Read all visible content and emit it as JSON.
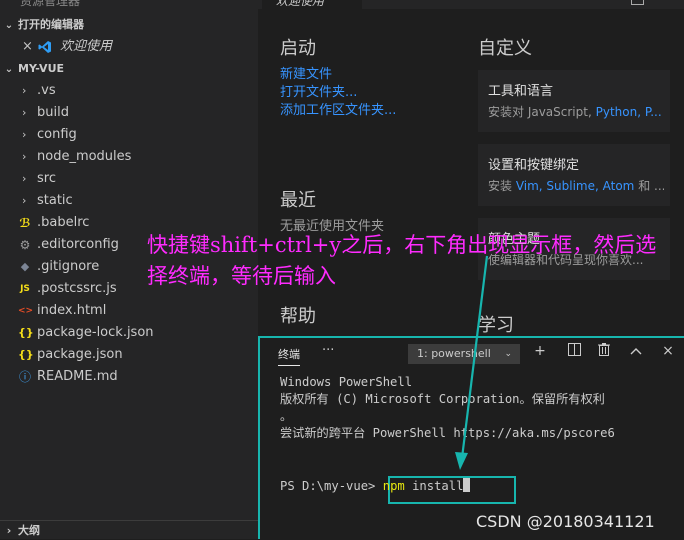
{
  "sidebar": {
    "top_cut_text": "资源管理器",
    "open_editors": {
      "header": "打开的编辑器",
      "items": [
        {
          "label": "欢迎使用",
          "close_glyph": "×"
        }
      ]
    },
    "project": {
      "header": "MY-VUE",
      "folders": [
        ".vs",
        "build",
        "config",
        "node_modules",
        "src",
        "static"
      ],
      "files": [
        {
          "name": ".babelrc",
          "icon": "babel-icon",
          "color": "#f5de19"
        },
        {
          "name": ".editorconfig",
          "icon": "gear-icon",
          "color": "#9d9d9d"
        },
        {
          "name": ".gitignore",
          "icon": "diamond-icon",
          "color": "#7c8595"
        },
        {
          "name": ".postcssrc.js",
          "icon": "js-icon",
          "color": "#f5de19",
          "glyph": "JS"
        },
        {
          "name": "index.html",
          "icon": "html-icon",
          "color": "#e44d26"
        },
        {
          "name": "package-lock.json",
          "icon": "json-icon",
          "color": "#f5de19",
          "glyph": "{}"
        },
        {
          "name": "package.json",
          "icon": "json-icon",
          "color": "#f5de19",
          "glyph": "{}"
        },
        {
          "name": "README.md",
          "icon": "info-icon",
          "color": "#42a5f5"
        }
      ]
    },
    "outline_header": "大纲"
  },
  "editor": {
    "tab_label": "欢迎使用",
    "start": {
      "title": "启动",
      "links": [
        "新建文件",
        "打开文件夹...",
        "添加工作区文件夹..."
      ]
    },
    "recent": {
      "title": "最近",
      "empty_text": "无最近使用文件夹"
    },
    "help": {
      "title": "帮助"
    },
    "customize": {
      "title": "自定义",
      "cards": [
        {
          "title": "工具和语言",
          "desc_prefix": "安装对 JavaScript, ",
          "desc_links": "Python, P..."
        },
        {
          "title": "设置和按键绑定",
          "desc_prefix": "安装 ",
          "desc_links": "Vim, Sublime, Atom",
          "desc_suffix": " 和 ..."
        },
        {
          "title": "颜色主题",
          "desc_prefix": "使编辑器和代码呈现你喜欢...",
          "desc_links": ""
        }
      ]
    },
    "learn": {
      "title": "学习"
    }
  },
  "annotation": "快捷键shift+ctrl+y之后，右下角出现显示框，然后选择终端，等待后输入",
  "terminal": {
    "tab_label": "终端",
    "more_glyph": "···",
    "shell_select": "1: powershell",
    "icons": [
      "plus-icon",
      "split-icon",
      "trash-icon",
      "chevron-up-icon",
      "close-icon"
    ],
    "lines": [
      "Windows PowerShell",
      "版权所有 (C) Microsoft Corporation。保留所有权利",
      "。",
      "",
      "尝试新的跨平台 PowerShell https://aka.ms/pscore6"
    ],
    "prompt": "PS D:\\my-vue> ",
    "command_name": "npm",
    "command_args": " install"
  },
  "watermark": "CSDN @20180341121",
  "colors": {
    "accent_highlight": "#17b5ae",
    "annotation": "#ff2bff",
    "link": "#3794ff"
  }
}
